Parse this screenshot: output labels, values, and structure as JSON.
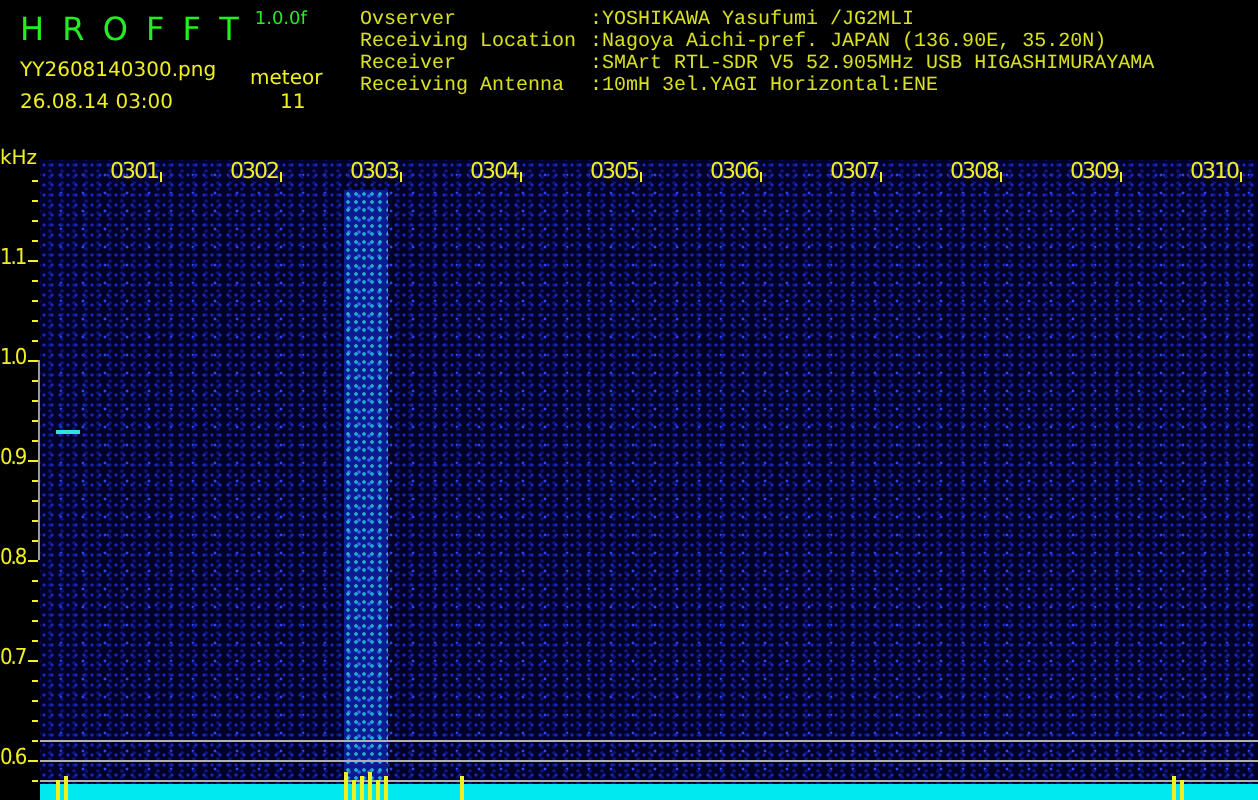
{
  "header": {
    "title": "H R O F F T",
    "version": "1.0.0f",
    "filename": "YY2608140300.png",
    "detection_label": "meteor",
    "datetime": "26.08.14 03:00",
    "count": "11"
  },
  "info": [
    {
      "label": "Ovserver",
      "value": ":YOSHIKAWA Yasufumi /JG2MLI"
    },
    {
      "label": "Receiving Location",
      "value": ":Nagoya Aichi-pref. JAPAN (136.90E, 35.20N)"
    },
    {
      "label": "Receiver",
      "value": ":SMArt RTL-SDR V5 52.905MHz USB HIGASHIMURAYAMA"
    },
    {
      "label": "Receiving Antenna",
      "value": ":10mH 3el.YAGI Horizontal:ENE"
    }
  ],
  "plot": {
    "unit_label": "kHz",
    "time_labels": [
      "0301",
      "0302",
      "0303",
      "0304",
      "0305",
      "0306",
      "0307",
      "0308",
      "0309",
      "0310"
    ],
    "frequency_labels": [
      "1.1",
      "1.0",
      "0.9",
      "0.8",
      "0.7",
      "0.6"
    ]
  }
}
